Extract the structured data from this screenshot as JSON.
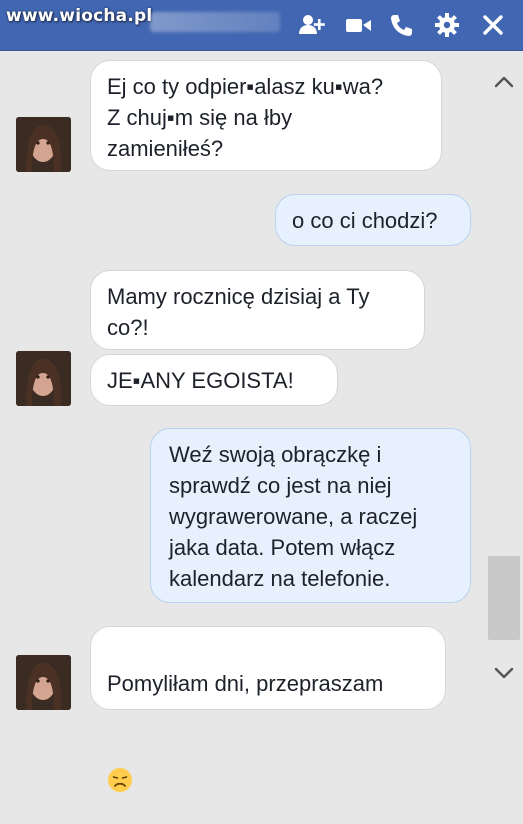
{
  "header": {
    "watermark": "www.wiocha.pl",
    "icons": [
      "add-people-icon",
      "video-camera-icon",
      "phone-icon",
      "gear-icon",
      "close-icon"
    ],
    "color": "#4267b2"
  },
  "messages": [
    {
      "side": "received",
      "text": "Ej co ty odpier▪alasz ku▪wa?\nZ chuj▪m się na łby\nzamieniłeś?"
    },
    {
      "side": "sent",
      "text": "o co ci chodzi?"
    },
    {
      "side": "received",
      "text": "Mamy rocznicę dzisiaj a Ty\nco?!"
    },
    {
      "side": "received",
      "text": "JE▪ANY EGOISTA!"
    },
    {
      "side": "sent",
      "text": "Weź swoją obrączkę i\nsprawdź co jest na niej\nwygrawerowane, a raczej\njaka data. Potem włącz\nkalendarz na telefonie."
    },
    {
      "side": "received",
      "text": "Pomyliłam dni, przepraszam",
      "emoji": "disappointed-face-icon"
    }
  ],
  "colors": {
    "received_bubble": "#ffffff",
    "sent_bubble": "#e7f1fd",
    "background": "#e7e7e7"
  }
}
